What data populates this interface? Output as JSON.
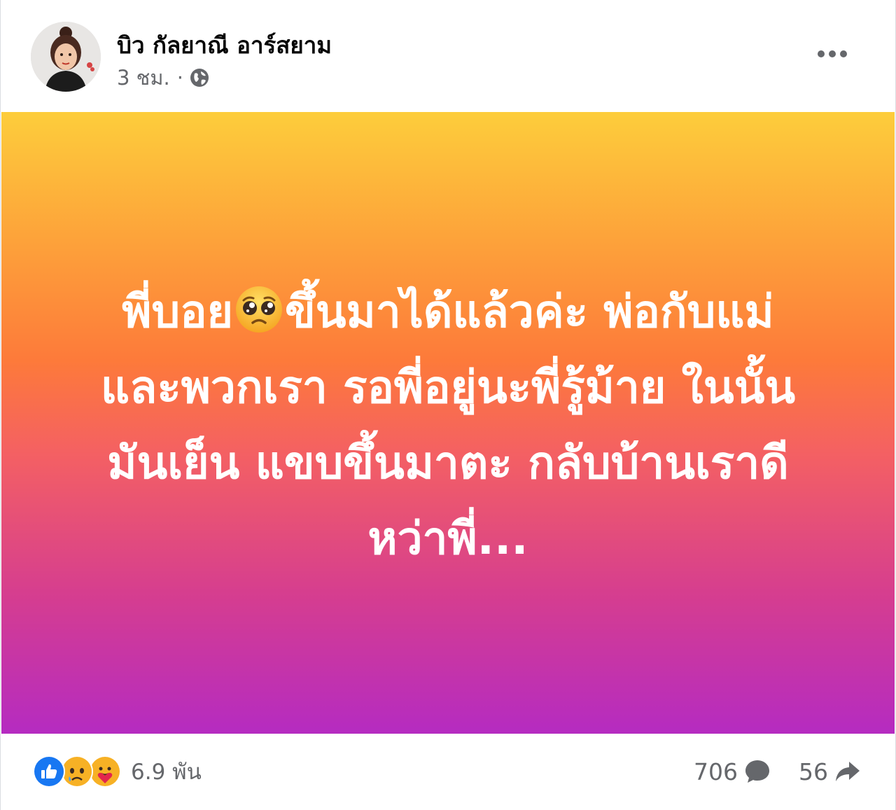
{
  "author": {
    "name": "บิว กัลยาณี อาร์สยาม",
    "avatar_icon": "profile-photo"
  },
  "meta": {
    "time": "3 ชม.",
    "separator": "·",
    "privacy_icon": "globe-icon"
  },
  "more_icon": "more-horizontal-icon",
  "post": {
    "line1_before_emoji": "พี่บอย",
    "emoji": "pleading-face",
    "line1_after_emoji": "ขึ้นมาได้แล้วค่ะ พ่อกับแม่",
    "line2": "และพวกเรา รอพี่อยู่นะพี่รู้ม้าย ในนั้น",
    "line3": "มันเย็น แขบขึ้นมาตะ กลับบ้านเราดี",
    "line4": "หว่าพี่...",
    "background": [
      "#fdcd3b",
      "#fd7a3a",
      "#d53d90",
      "#b52bc1"
    ]
  },
  "reactions": {
    "icons": [
      "like-icon",
      "sad-icon",
      "care-icon"
    ],
    "count": "6.9 พัน"
  },
  "comments": {
    "count": "706",
    "icon": "comment-icon"
  },
  "shares": {
    "count": "56",
    "icon": "share-icon"
  },
  "colors": {
    "like": "#1877f2",
    "sad": "#f7b125",
    "secondary_text": "#65676b"
  }
}
